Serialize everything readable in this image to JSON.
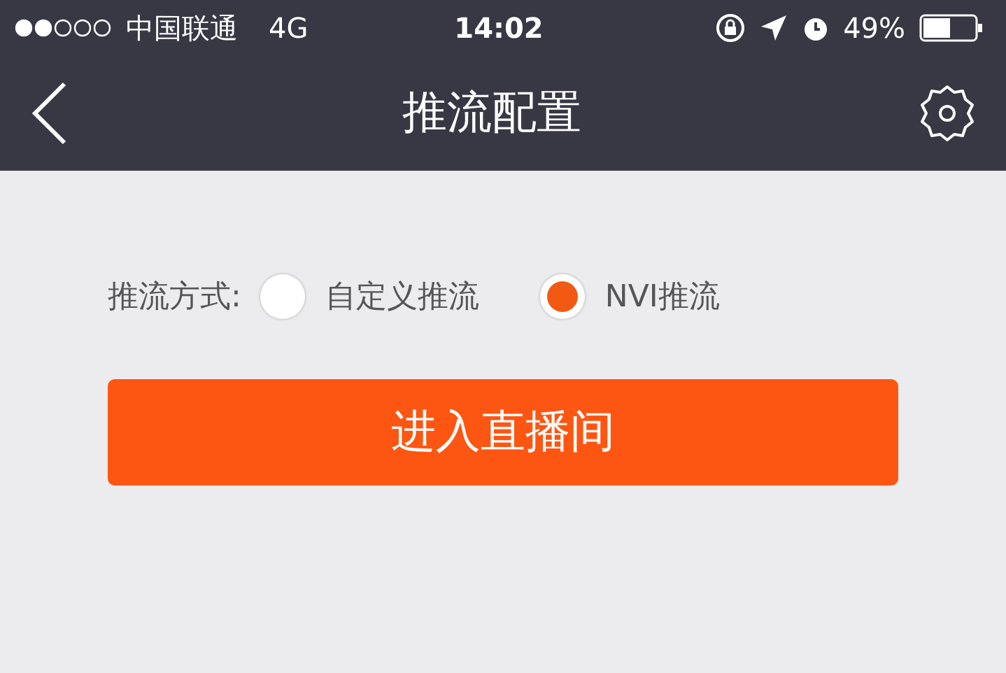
{
  "status_bar": {
    "carrier": "中国联通",
    "network": "4G",
    "time": "14:02",
    "battery": "49%"
  },
  "nav_bar": {
    "title": "推流配置"
  },
  "push_mode": {
    "label": "推流方式:",
    "options": [
      {
        "label": "自定义推流",
        "selected": false
      },
      {
        "label": "NVI推流",
        "selected": true
      }
    ]
  },
  "enter_button": "进入直播间"
}
